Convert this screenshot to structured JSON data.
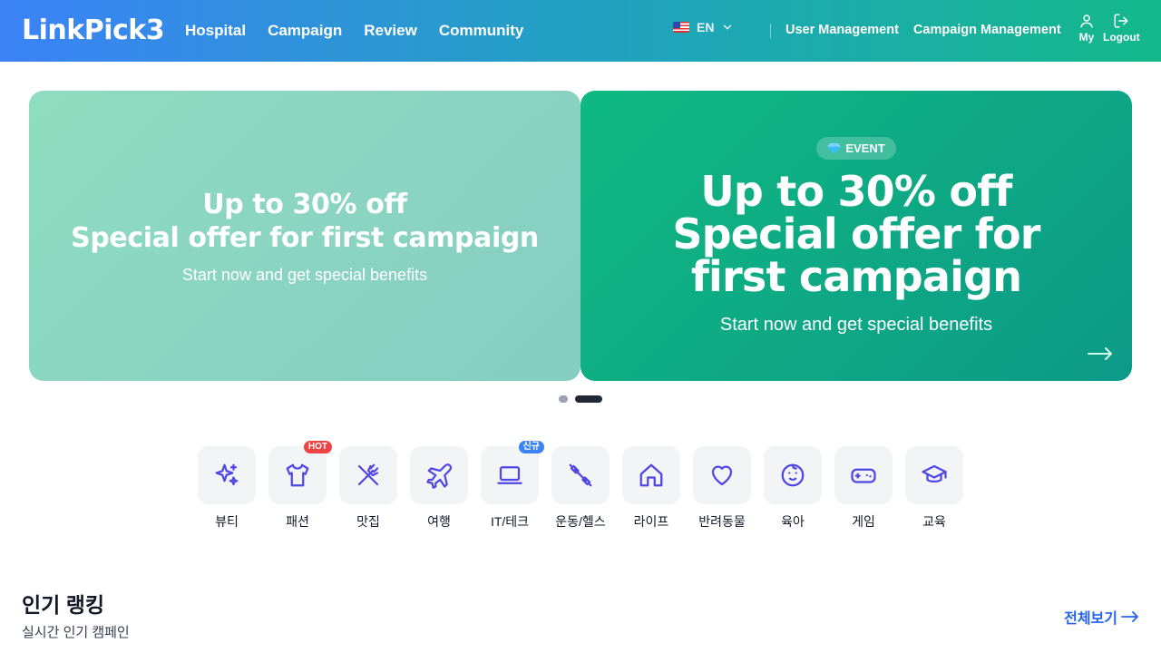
{
  "header": {
    "logo": "LinkPick3",
    "nav": [
      "Hospital",
      "Campaign",
      "Review",
      "Community"
    ],
    "language": "EN",
    "admin_links": [
      "User Management",
      "Campaign Management"
    ],
    "my_label": "My",
    "logout_label": "Logout"
  },
  "banners": {
    "left": {
      "title_line1": "Up to 30% off",
      "title_line2": "Special offer for first campaign",
      "subtitle": "Start now and get special benefits"
    },
    "right": {
      "badge": "EVENT",
      "title": "Up to 30% off Special offer for first campaign",
      "subtitle": "Start now and get special benefits"
    },
    "slide_count": 2,
    "active_slide": 2
  },
  "categories": [
    {
      "label": "뷰티",
      "icon": "sparkles-icon",
      "tag": ""
    },
    {
      "label": "패션",
      "icon": "shirt-icon",
      "tag": "HOT"
    },
    {
      "label": "맛집",
      "icon": "utensils-icon",
      "tag": ""
    },
    {
      "label": "여행",
      "icon": "airplane-icon",
      "tag": ""
    },
    {
      "label": "IT/테크",
      "icon": "laptop-icon",
      "tag": "신규"
    },
    {
      "label": "운동/헬스",
      "icon": "dumbbell-icon",
      "tag": ""
    },
    {
      "label": "라이프",
      "icon": "home-icon",
      "tag": ""
    },
    {
      "label": "반려동물",
      "icon": "heart-icon",
      "tag": ""
    },
    {
      "label": "육아",
      "icon": "baby-icon",
      "tag": ""
    },
    {
      "label": "게임",
      "icon": "gamepad-icon",
      "tag": ""
    },
    {
      "label": "교육",
      "icon": "graduation-cap-icon",
      "tag": ""
    }
  ],
  "ranking": {
    "title": "인기 랭킹",
    "subtitle": "실시간 인기 캠페인",
    "see_all": "전체보기"
  },
  "colors": {
    "accent": "#4f46e5",
    "link": "#2563eb",
    "hot": "#ef4444",
    "new": "#3b82f6"
  }
}
